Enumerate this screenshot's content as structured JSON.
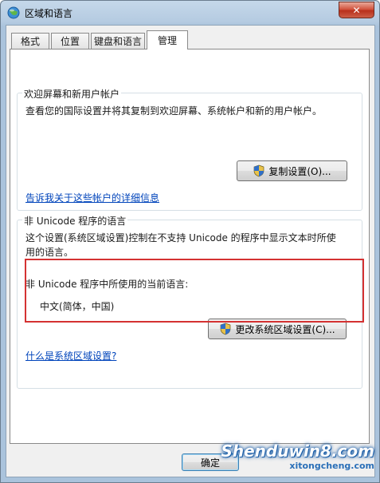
{
  "window": {
    "title": "区域和语言",
    "close_label": "✕"
  },
  "tabs": [
    {
      "label": "格式",
      "active": false
    },
    {
      "label": "位置",
      "active": false
    },
    {
      "label": "键盘和语言",
      "active": false
    },
    {
      "label": "管理",
      "active": true
    }
  ],
  "welcome_group": {
    "title": "欢迎屏幕和新用户帐户",
    "description": "查看您的国际设置并将其复制到欢迎屏幕、系统帐户和新的用户帐户。",
    "copy_button": "复制设置(O)...",
    "link": "告诉我关于这些帐户的详细信息"
  },
  "unicode_group": {
    "title": "非 Unicode 程序的语言",
    "description_line1": "这个设置(系统区域设置)控制在不支持 Unicode 的程序中显示文本时所使",
    "description_line2": "用的语言。",
    "current_label": "非 Unicode 程序中所使用的当前语言:",
    "current_value": "中文(简体，中国)",
    "change_button": "更改系统区域设置(C)...",
    "link": "什么是系统区域设置?"
  },
  "footer": {
    "ok_button": "确定"
  },
  "watermark": {
    "main": "Shenduwin8.com",
    "sub": "xitongcheng.com"
  },
  "colors": {
    "accent_red": "#d43232",
    "link_blue": "#0044bb"
  }
}
